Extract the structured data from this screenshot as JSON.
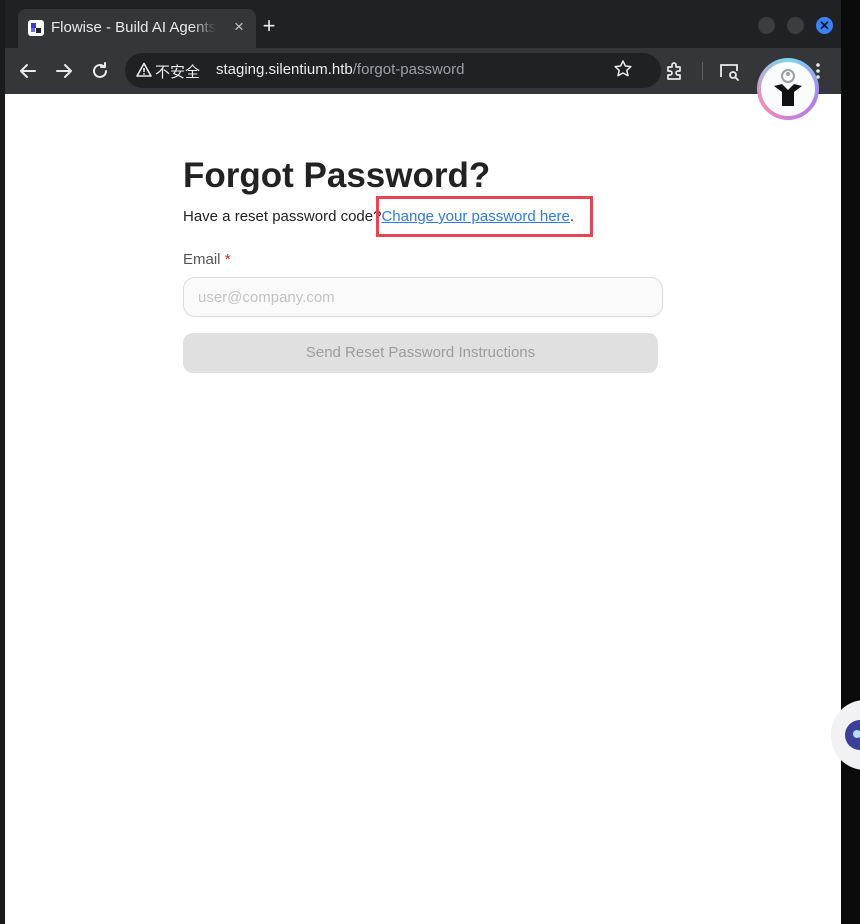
{
  "browser": {
    "tab_title": "Flowise - Build AI Agents",
    "tab_close": "×",
    "new_tab": "+",
    "window_close": "✕",
    "security_label": "不安全",
    "url_host": "staging.silentium.htb",
    "url_path": "/forgot-password",
    "icons": {
      "back": "back-arrow-icon",
      "forward": "forward-arrow-icon",
      "reload": "reload-icon",
      "warning": "warning-triangle-icon",
      "bookmark": "star-icon",
      "extensions": "puzzle-piece-icon",
      "cast": "cast-search-icon",
      "profile": "profile-icon",
      "menu": "kebab-menu-icon"
    }
  },
  "page": {
    "heading": "Forgot Password?",
    "reset_prompt": "Have a reset password code?",
    "reset_link": "Change your password here",
    "reset_suffix": ".",
    "email_label": "Email",
    "required_marker": "*",
    "email_placeholder": "user@company.com",
    "email_value": "",
    "submit_label": "Send Reset Password Instructions"
  },
  "colors": {
    "link": "#2c7be5",
    "highlight": "#e64553",
    "required": "#e11d24",
    "button_disabled_bg": "#e0e0e0"
  }
}
